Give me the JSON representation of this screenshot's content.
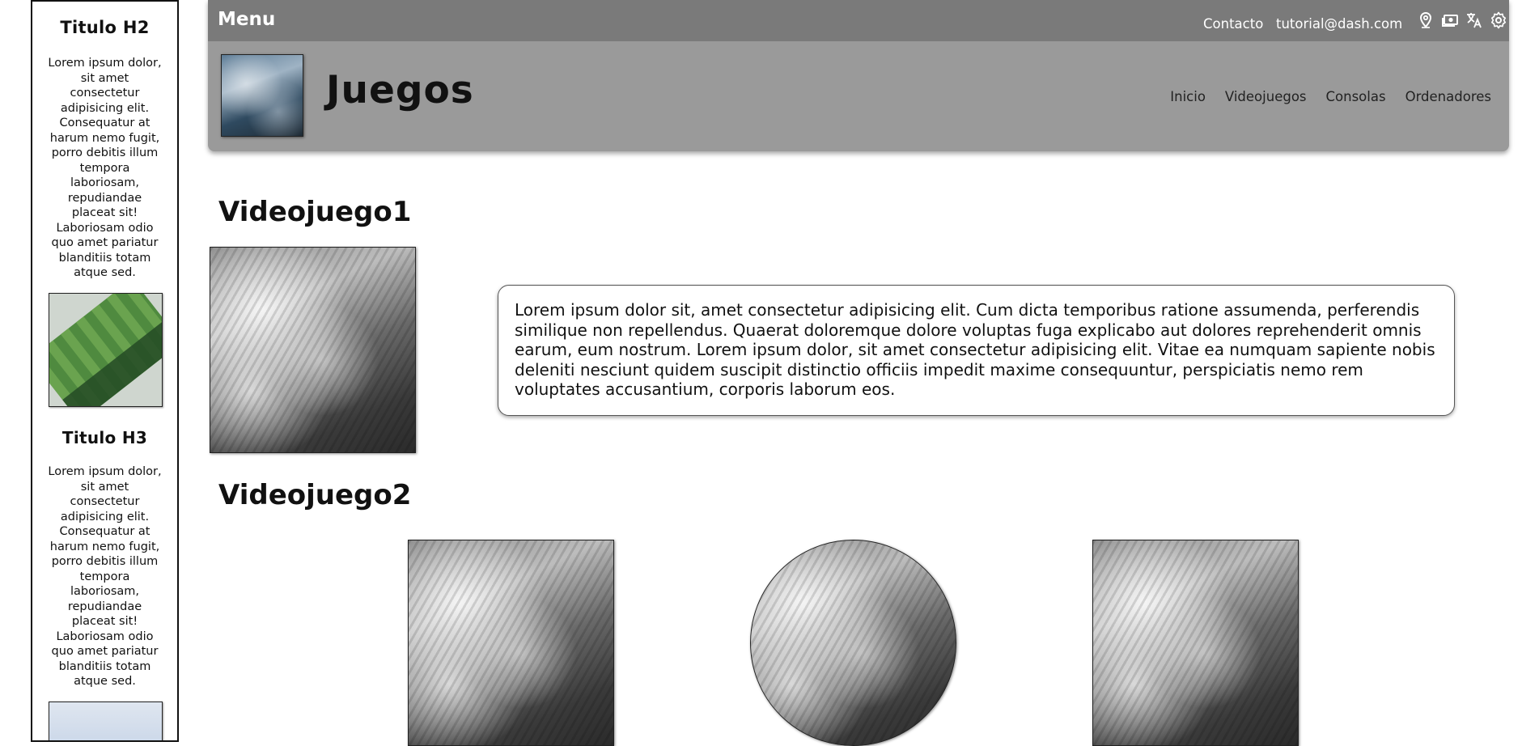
{
  "aside": {
    "title_h2": "Titulo H2",
    "text1": "Lorem ipsum dolor, sit amet consectetur adipisicing elit. Consequatur at harum nemo fugit, porro debitis illum tempora laboriosam, repudiandae placeat sit! Laboriosam odio quo amet pariatur blanditiis totam atque sed.",
    "title_h3": "Titulo H3",
    "text2": "Lorem ipsum dolor, sit amet consectetur adipisicing elit. Consequatur at harum nemo fugit, porro debitis illum tempora laboriosam, repudiandae placeat sit! Laboriosam odio quo amet pariatur blanditiis totam atque sed."
  },
  "header": {
    "menu_label": "Menu",
    "contact_label": "Contacto",
    "email": "tutorial@dash.com",
    "icons": [
      "location-icon",
      "money-icon",
      "translate-icon",
      "settings-icon"
    ],
    "site_title": "Juegos",
    "nav": [
      "Inicio",
      "Videojuegos",
      "Consolas",
      "Ordenadores"
    ]
  },
  "main": {
    "section1_title": "Videojuego1",
    "section1_text": "Lorem ipsum dolor sit, amet consectetur adipisicing elit. Cum dicta temporibus ratione assumenda, perferendis similique non repellendus. Quaerat doloremque dolore voluptas fuga explicabo aut dolores reprehenderit omnis earum, eum nostrum. Lorem ipsum dolor, sit amet consectetur adipisicing elit. Vitae ea numquam sapiente nobis deleniti nesciunt quidem suscipit distinctio officiis impedit maxime consequuntur, perspiciatis nemo rem voluptates accusantium, corporis laborum eos.",
    "section2_title": "Videojuego2"
  },
  "colors": {
    "header_bg": "#9a9a9a",
    "topbar_bg": "#7a7a7a"
  }
}
